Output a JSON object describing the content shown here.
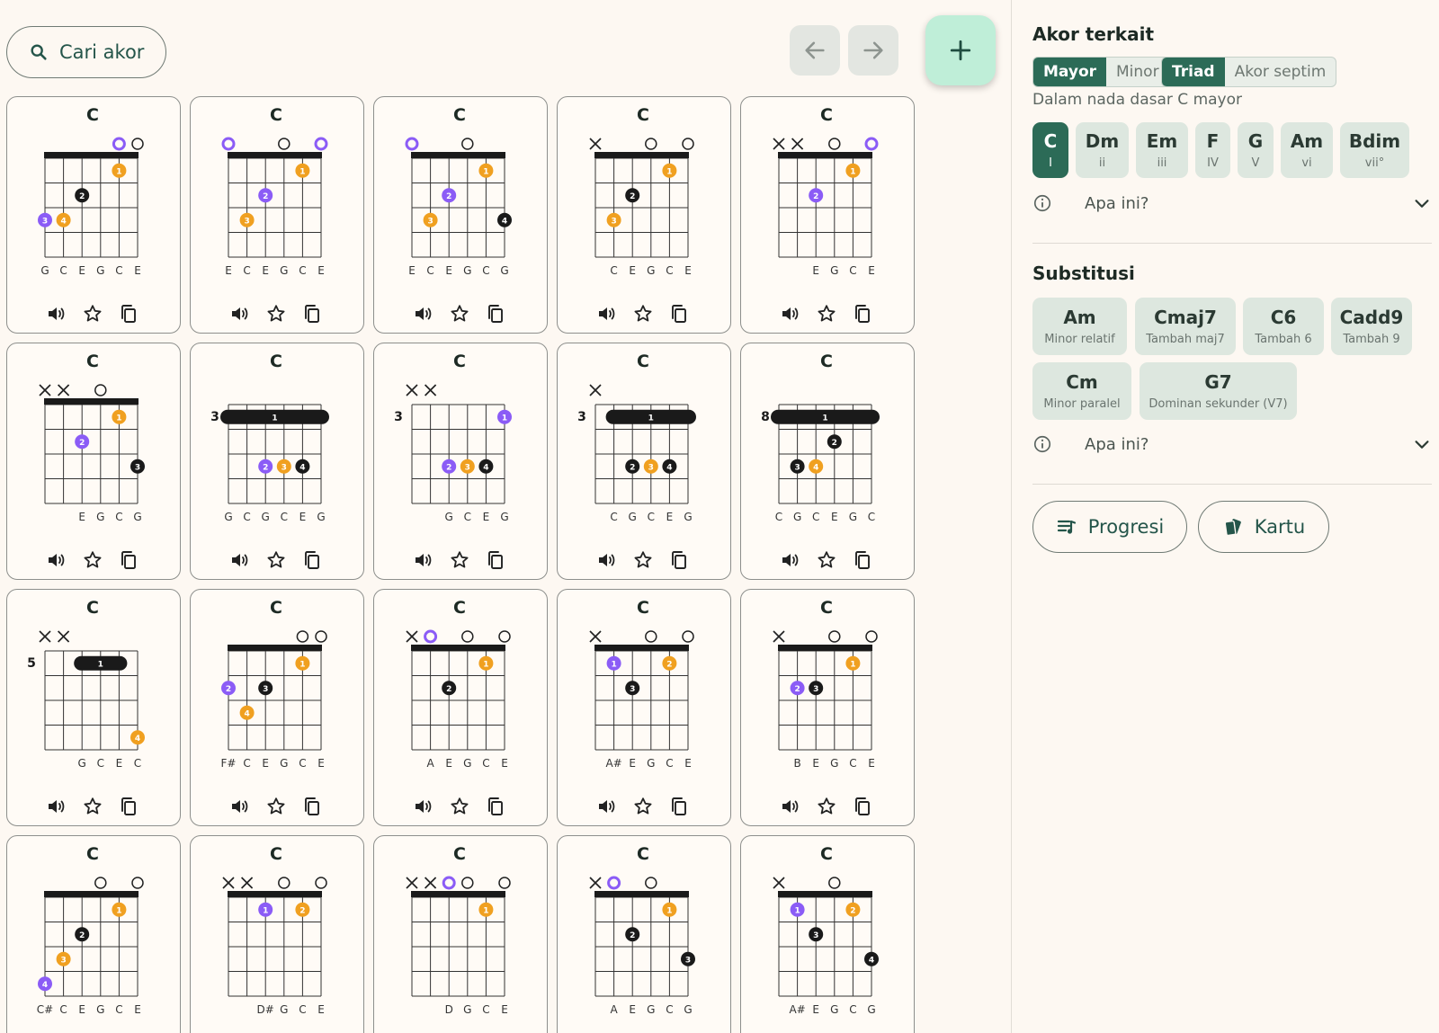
{
  "search": {
    "label": "Cari akor"
  },
  "nav": {
    "back_icon": "arrow-left-icon",
    "forward_icon": "arrow-right-icon",
    "add_icon": "plus-icon"
  },
  "colors": {
    "accent": "#2c6b57",
    "finger1": "#f0a020",
    "finger2": "#8b5cf6",
    "finger3": "#1a1a1a",
    "open_highlight": "#8b5cf6"
  },
  "cards": [
    {
      "name": "C",
      "fret": null,
      "top": [
        "",
        "",
        "",
        "",
        "oP",
        "o"
      ],
      "dots": [
        [
          5,
          1,
          1,
          "o"
        ],
        [
          3,
          2,
          2,
          "k"
        ],
        [
          1,
          3,
          3,
          "p"
        ],
        [
          2,
          3,
          4,
          "o"
        ]
      ],
      "barre": null,
      "strings": [
        "G",
        "C",
        "E",
        "G",
        "C",
        "E"
      ]
    },
    {
      "name": "C",
      "fret": null,
      "top": [
        "oP",
        "",
        "",
        "o",
        "",
        "oP"
      ],
      "dots": [
        [
          5,
          1,
          1,
          "o"
        ],
        [
          3,
          2,
          2,
          "p"
        ],
        [
          2,
          3,
          3,
          "o"
        ]
      ],
      "barre": null,
      "strings": [
        "E",
        "C",
        "E",
        "G",
        "C",
        "E"
      ]
    },
    {
      "name": "C",
      "fret": null,
      "top": [
        "oP",
        "",
        "",
        "o",
        "",
        ""
      ],
      "dots": [
        [
          5,
          1,
          1,
          "o"
        ],
        [
          3,
          2,
          2,
          "p"
        ],
        [
          2,
          3,
          3,
          "o"
        ],
        [
          6,
          3,
          4,
          "k"
        ]
      ],
      "barre": null,
      "strings": [
        "E",
        "C",
        "E",
        "G",
        "C",
        "G"
      ]
    },
    {
      "name": "C",
      "fret": null,
      "top": [
        "x",
        "",
        "",
        "o",
        "",
        "o"
      ],
      "dots": [
        [
          5,
          1,
          1,
          "o"
        ],
        [
          3,
          2,
          2,
          "k"
        ],
        [
          2,
          3,
          3,
          "o"
        ]
      ],
      "barre": null,
      "strings": [
        "",
        "C",
        "E",
        "G",
        "C",
        "E"
      ]
    },
    {
      "name": "C",
      "fret": null,
      "top": [
        "x",
        "x",
        "",
        "o",
        "",
        "oP"
      ],
      "dots": [
        [
          5,
          1,
          1,
          "o"
        ],
        [
          3,
          2,
          2,
          "p"
        ]
      ],
      "barre": null,
      "strings": [
        "",
        "",
        "E",
        "G",
        "C",
        "E"
      ]
    },
    {
      "name": "C",
      "fret": null,
      "top": [
        "x",
        "x",
        "",
        "o",
        "",
        ""
      ],
      "dots": [
        [
          5,
          1,
          1,
          "o"
        ],
        [
          3,
          2,
          2,
          "p"
        ],
        [
          6,
          3,
          3,
          "k"
        ]
      ],
      "barre": null,
      "strings": [
        "",
        "",
        "E",
        "G",
        "C",
        "G"
      ]
    },
    {
      "name": "C",
      "fret": "3",
      "top": [
        "",
        "",
        "",
        "",
        "",
        ""
      ],
      "dots": [
        [
          3,
          3,
          2,
          "p"
        ],
        [
          4,
          3,
          3,
          "o"
        ],
        [
          5,
          3,
          4,
          "k"
        ]
      ],
      "barre": [
        1,
        6,
        1,
        "1"
      ],
      "strings": [
        "G",
        "C",
        "G",
        "C",
        "E",
        "G"
      ]
    },
    {
      "name": "C",
      "fret": "3",
      "top": [
        "x",
        "x",
        "",
        "",
        "",
        ""
      ],
      "dots": [
        [
          6,
          1,
          1,
          "p"
        ],
        [
          3,
          3,
          2,
          "p"
        ],
        [
          4,
          3,
          3,
          "o"
        ],
        [
          5,
          3,
          4,
          "k"
        ]
      ],
      "barre": null,
      "strings": [
        "",
        "",
        "G",
        "C",
        "E",
        "G"
      ]
    },
    {
      "name": "C",
      "fret": "3",
      "top": [
        "x",
        "",
        "",
        "",
        "",
        ""
      ],
      "dots": [
        [
          3,
          3,
          2,
          "k"
        ],
        [
          4,
          3,
          3,
          "o"
        ],
        [
          5,
          3,
          4,
          "k"
        ]
      ],
      "barre": [
        2,
        6,
        1,
        "1"
      ],
      "strings": [
        "",
        "C",
        "G",
        "C",
        "E",
        "G"
      ]
    },
    {
      "name": "C",
      "fret": "8",
      "top": [
        "",
        "",
        "",
        "",
        "",
        ""
      ],
      "dots": [
        [
          4,
          2,
          2,
          "k"
        ],
        [
          2,
          3,
          3,
          "k"
        ],
        [
          3,
          3,
          4,
          "o"
        ]
      ],
      "barre": [
        1,
        6,
        1,
        "1"
      ],
      "strings": [
        "C",
        "G",
        "C",
        "E",
        "G",
        "C"
      ]
    },
    {
      "name": "C",
      "fret": "5",
      "top": [
        "x",
        "x",
        "",
        "",
        "",
        ""
      ],
      "dots": [
        [
          6,
          4,
          4,
          "o"
        ]
      ],
      "barre": [
        3,
        5,
        1,
        "1"
      ],
      "strings": [
        "",
        "",
        "G",
        "C",
        "E",
        "C"
      ]
    },
    {
      "name": "C",
      "fret": null,
      "top": [
        "",
        "",
        "",
        "",
        "o",
        "o"
      ],
      "dots": [
        [
          5,
          1,
          1,
          "o"
        ],
        [
          1,
          2,
          2,
          "p"
        ],
        [
          3,
          2,
          3,
          "k"
        ],
        [
          2,
          3,
          4,
          "o"
        ]
      ],
      "barre": null,
      "strings": [
        "F#",
        "C",
        "E",
        "G",
        "C",
        "E"
      ]
    },
    {
      "name": "C",
      "fret": null,
      "top": [
        "x",
        "oP",
        "",
        "o",
        "",
        "o"
      ],
      "dots": [
        [
          5,
          1,
          1,
          "o"
        ],
        [
          3,
          2,
          2,
          "k"
        ]
      ],
      "barre": null,
      "strings": [
        "",
        "A",
        "E",
        "G",
        "C",
        "E"
      ]
    },
    {
      "name": "C",
      "fret": null,
      "top": [
        "x",
        "",
        "",
        "o",
        "",
        "o"
      ],
      "dots": [
        [
          2,
          1,
          1,
          "p"
        ],
        [
          5,
          1,
          2,
          "o"
        ],
        [
          3,
          2,
          3,
          "k"
        ]
      ],
      "barre": null,
      "strings": [
        "",
        "A#",
        "E",
        "G",
        "C",
        "E"
      ]
    },
    {
      "name": "C",
      "fret": null,
      "top": [
        "x",
        "",
        "",
        "o",
        "",
        "o"
      ],
      "dots": [
        [
          5,
          1,
          1,
          "o"
        ],
        [
          2,
          2,
          2,
          "p"
        ],
        [
          3,
          2,
          3,
          "k"
        ]
      ],
      "barre": null,
      "strings": [
        "",
        "B",
        "E",
        "G",
        "C",
        "E"
      ]
    },
    {
      "name": "C",
      "fret": null,
      "top": [
        "",
        "",
        "",
        "o",
        "",
        "o"
      ],
      "dots": [
        [
          5,
          1,
          1,
          "o"
        ],
        [
          3,
          2,
          2,
          "k"
        ],
        [
          2,
          3,
          3,
          "o"
        ],
        [
          1,
          4,
          4,
          "p"
        ]
      ],
      "barre": null,
      "strings": [
        "C#",
        "C",
        "E",
        "G",
        "C",
        "E"
      ]
    },
    {
      "name": "C",
      "fret": null,
      "top": [
        "x",
        "x",
        "",
        "o",
        "",
        "o"
      ],
      "dots": [
        [
          3,
          1,
          1,
          "p"
        ],
        [
          5,
          1,
          2,
          "o"
        ]
      ],
      "barre": null,
      "strings": [
        "",
        "",
        "D#",
        "G",
        "C",
        "E"
      ]
    },
    {
      "name": "C",
      "fret": null,
      "top": [
        "x",
        "x",
        "oP",
        "o",
        "",
        "o"
      ],
      "dots": [
        [
          5,
          1,
          1,
          "o"
        ]
      ],
      "barre": null,
      "strings": [
        "",
        "",
        "D",
        "G",
        "C",
        "E"
      ]
    },
    {
      "name": "C",
      "fret": null,
      "top": [
        "x",
        "oP",
        "",
        "o",
        "",
        ""
      ],
      "dots": [
        [
          5,
          1,
          1,
          "o"
        ],
        [
          3,
          2,
          2,
          "k"
        ],
        [
          6,
          3,
          3,
          "k"
        ]
      ],
      "barre": null,
      "strings": [
        "",
        "A",
        "E",
        "G",
        "C",
        "G"
      ]
    },
    {
      "name": "C",
      "fret": null,
      "top": [
        "x",
        "",
        "",
        "o",
        "",
        ""
      ],
      "dots": [
        [
          2,
          1,
          1,
          "p"
        ],
        [
          5,
          1,
          2,
          "o"
        ],
        [
          3,
          2,
          3,
          "k"
        ],
        [
          6,
          3,
          4,
          "k"
        ]
      ],
      "barre": null,
      "strings": [
        "",
        "A#",
        "E",
        "G",
        "C",
        "G"
      ]
    }
  ],
  "card_actions": {
    "play": "speaker-icon",
    "favorite": "star-icon",
    "copy": "copy-icon"
  },
  "related": {
    "title": "Akor terkait",
    "mode_tabs": [
      "Mayor",
      "Minor"
    ],
    "type_tabs": [
      "Triad",
      "Akor septim"
    ],
    "key_label": "Dalam nada dasar C mayor",
    "degrees": [
      {
        "name": "C",
        "roman": "I"
      },
      {
        "name": "Dm",
        "roman": "ii"
      },
      {
        "name": "Em",
        "roman": "iii"
      },
      {
        "name": "F",
        "roman": "IV"
      },
      {
        "name": "G",
        "roman": "V"
      },
      {
        "name": "Am",
        "roman": "vi"
      },
      {
        "name": "Bdim",
        "roman": "vii°"
      }
    ],
    "info_label": "Apa ini?"
  },
  "substitution": {
    "title": "Substitusi",
    "items": [
      {
        "name": "Am",
        "desc": "Minor relatif"
      },
      {
        "name": "Cmaj7",
        "desc": "Tambah maj7"
      },
      {
        "name": "C6",
        "desc": "Tambah 6"
      },
      {
        "name": "Cadd9",
        "desc": "Tambah 9"
      },
      {
        "name": "Cm",
        "desc": "Minor paralel"
      },
      {
        "name": "G7",
        "desc": "Dominan sekunder (V7)"
      }
    ],
    "info_label": "Apa ini?"
  },
  "actions": {
    "progression": "Progresi",
    "cards": "Kartu"
  }
}
